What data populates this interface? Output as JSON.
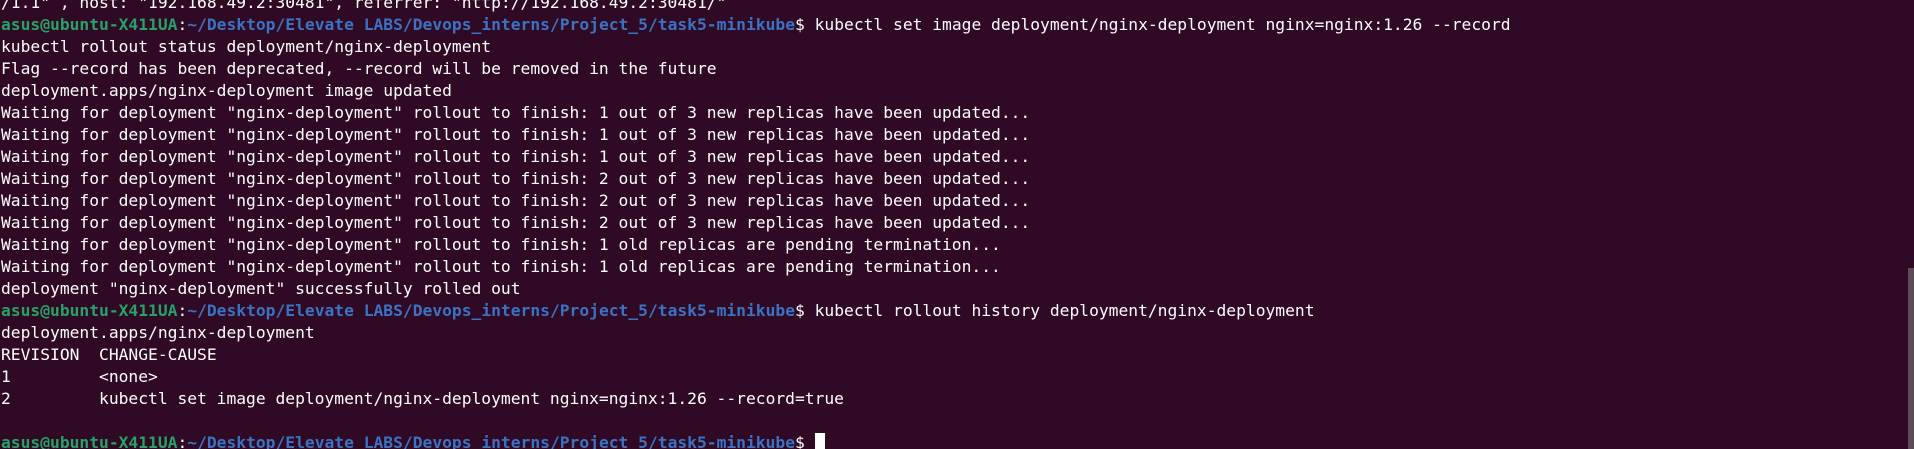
{
  "terminal": {
    "prompt_user": "asus@ubuntu-X411UA",
    "prompt_path": "~/Desktop/Elevate LABS/Devops_interns/Project_5/task5-minikube",
    "prompt_sep": ":",
    "prompt_symbol": "$ ",
    "top_partial": "/1.1\" , host: \"192.168.49.2:30481\", referrer: \"http://192.168.49.2:30481/\"",
    "cmd1": "kubectl set image deployment/nginx-deployment nginx=nginx:1.26 --record",
    "out1": [
      "kubectl rollout status deployment/nginx-deployment",
      "Flag --record has been deprecated, --record will be removed in the future",
      "deployment.apps/nginx-deployment image updated",
      "Waiting for deployment \"nginx-deployment\" rollout to finish: 1 out of 3 new replicas have been updated...",
      "Waiting for deployment \"nginx-deployment\" rollout to finish: 1 out of 3 new replicas have been updated...",
      "Waiting for deployment \"nginx-deployment\" rollout to finish: 1 out of 3 new replicas have been updated...",
      "Waiting for deployment \"nginx-deployment\" rollout to finish: 2 out of 3 new replicas have been updated...",
      "Waiting for deployment \"nginx-deployment\" rollout to finish: 2 out of 3 new replicas have been updated...",
      "Waiting for deployment \"nginx-deployment\" rollout to finish: 2 out of 3 new replicas have been updated...",
      "Waiting for deployment \"nginx-deployment\" rollout to finish: 1 old replicas are pending termination...",
      "Waiting for deployment \"nginx-deployment\" rollout to finish: 1 old replicas are pending termination...",
      "deployment \"nginx-deployment\" successfully rolled out"
    ],
    "cmd2": "kubectl rollout history deployment/nginx-deployment",
    "out2": [
      "deployment.apps/nginx-deployment",
      "REVISION  CHANGE-CAUSE",
      "1         <none>",
      "2         kubectl set image deployment/nginx-deployment nginx=nginx:1.26 --record=true",
      ""
    ],
    "cmd3": ""
  },
  "colors": {
    "background": "#300a24",
    "prompt_user": "#26a269",
    "prompt_path": "#3a73c4",
    "text": "#ffffff"
  }
}
